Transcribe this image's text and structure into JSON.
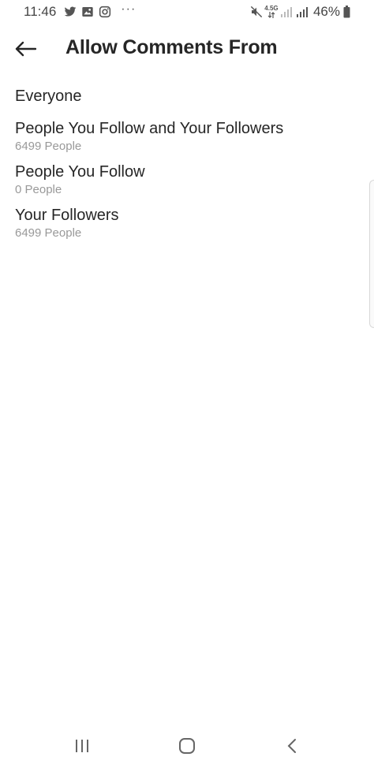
{
  "status_bar": {
    "time": "11:46",
    "battery": "46%",
    "network": "4.5G",
    "overflow": "···",
    "icons": [
      "twitter-icon",
      "gallery-icon",
      "instagram-icon",
      "mute-icon",
      "signal-icon",
      "battery-icon"
    ]
  },
  "header": {
    "title": "Allow Comments From",
    "back_icon": "arrow-left-icon"
  },
  "options": [
    {
      "label": "Everyone"
    },
    {
      "label": "People You Follow and Your Followers",
      "count": "6499 People"
    },
    {
      "label": "People You Follow",
      "count": "0 People"
    },
    {
      "label": "Your Followers",
      "count": "6499 People"
    }
  ],
  "nav_bar": {
    "icons": [
      "recent-apps-icon",
      "home-icon",
      "back-icon"
    ]
  }
}
